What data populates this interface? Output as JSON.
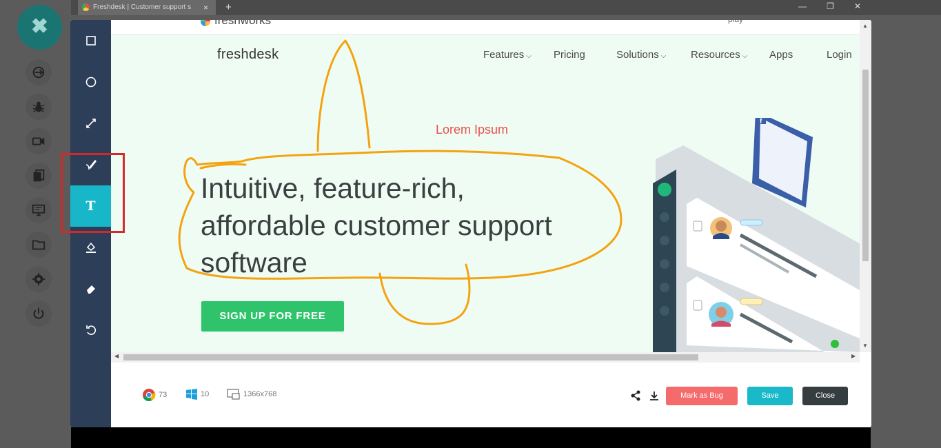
{
  "browser": {
    "tab_title": "Freshdesk | Customer support s",
    "tab_close": "×",
    "new_tab": "+",
    "window_controls": [
      "—",
      "❐",
      "✕"
    ]
  },
  "left_toolbar": {
    "close_glyph": "✖",
    "icons": [
      "sync-icon",
      "bug-icon",
      "video-icon",
      "copy-icon",
      "monitor-icon",
      "folder-icon",
      "gear-icon",
      "power-icon"
    ]
  },
  "tool_rail": {
    "tools": [
      "rectangle-tool",
      "circle-tool",
      "arrow-tool",
      "pen-tool",
      "text-tool",
      "fill-tool",
      "eraser-tool",
      "undo-tool"
    ],
    "active": "text-tool",
    "text_tool_glyph": "T"
  },
  "website": {
    "top_strip_logo": "freshworks",
    "top_strip_right": "play",
    "brand": "freshdesk",
    "nav": [
      {
        "label": "Features",
        "dropdown": "⌵"
      },
      {
        "label": "Pricing",
        "dropdown": ""
      },
      {
        "label": "Solutions",
        "dropdown": "⌵"
      },
      {
        "label": "Resources",
        "dropdown": "⌵"
      },
      {
        "label": "Apps",
        "dropdown": ""
      },
      {
        "label": "Login",
        "dropdown": ""
      }
    ],
    "annotation_text": "Lorem Ipsum",
    "hero_lines": [
      "Intuitive, feature-rich,",
      "affordable customer support",
      "software"
    ],
    "cta": "SIGN UP FOR FREE"
  },
  "footer": {
    "browser_version": "73",
    "os_version": "10",
    "resolution": "1366x768",
    "mark_bug": "Mark as Bug",
    "save": "Save",
    "close": "Close"
  },
  "colors": {
    "rail": "#2c3e58",
    "active_tool": "#17b6c8",
    "annotation": "#f4a20f",
    "cta": "#2fc46b",
    "bug_button": "#f56a6a",
    "save_button": "#19b9c9",
    "highlight_box": "#d62828"
  }
}
